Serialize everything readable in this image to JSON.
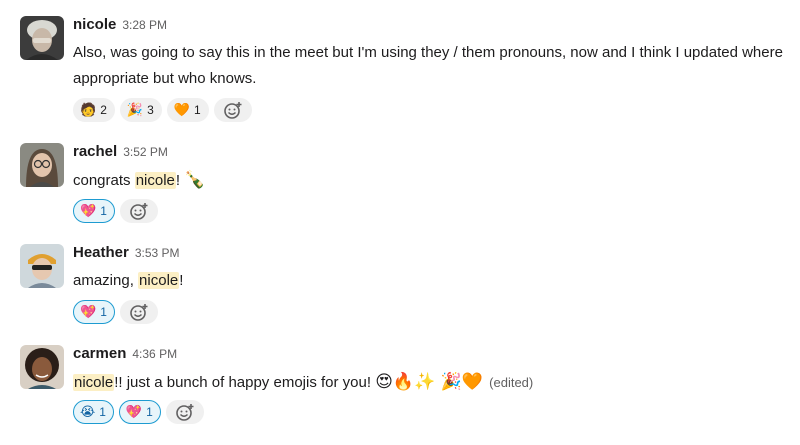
{
  "messages": [
    {
      "author": "nicole",
      "time": "3:28 PM",
      "text": "Also, was going to say this in the meet but I'm using they / them pronouns, now and I think I updated where appropriate but who knows.",
      "reactions": [
        {
          "emoji": "🧑",
          "count": "2"
        },
        {
          "emoji": "🎉",
          "count": "3"
        },
        {
          "emoji": "🧡",
          "count": "1"
        }
      ]
    },
    {
      "author": "rachel",
      "time": "3:52 PM",
      "text_before": "congrats ",
      "mention": "nicole",
      "text_after": "! ",
      "emoji": "🍾",
      "reactions": [
        {
          "emoji": "💖",
          "count": "1"
        }
      ]
    },
    {
      "author": "Heather",
      "time": "3:53 PM",
      "text_before": "amazing, ",
      "mention": "nicole",
      "text_after": "!",
      "reactions": [
        {
          "emoji": "💖",
          "count": "1"
        }
      ]
    },
    {
      "author": "carmen",
      "time": "4:36 PM",
      "mention": "nicole",
      "text_after": "!! just a bunch of happy emojis for you! ",
      "emojis": "😍🔥✨ 🎉🧡",
      "edited": "(edited)",
      "reactions": [
        {
          "emoji": "😭",
          "count": "1"
        },
        {
          "emoji": "💖",
          "count": "1"
        }
      ]
    }
  ],
  "icons": {
    "add_reaction": "add-reaction-icon"
  },
  "colors": {
    "mention_bg": "#fcefc4",
    "reaction_selected_border": "#1d9bd1",
    "reaction_bg": "#f0f0f0"
  }
}
